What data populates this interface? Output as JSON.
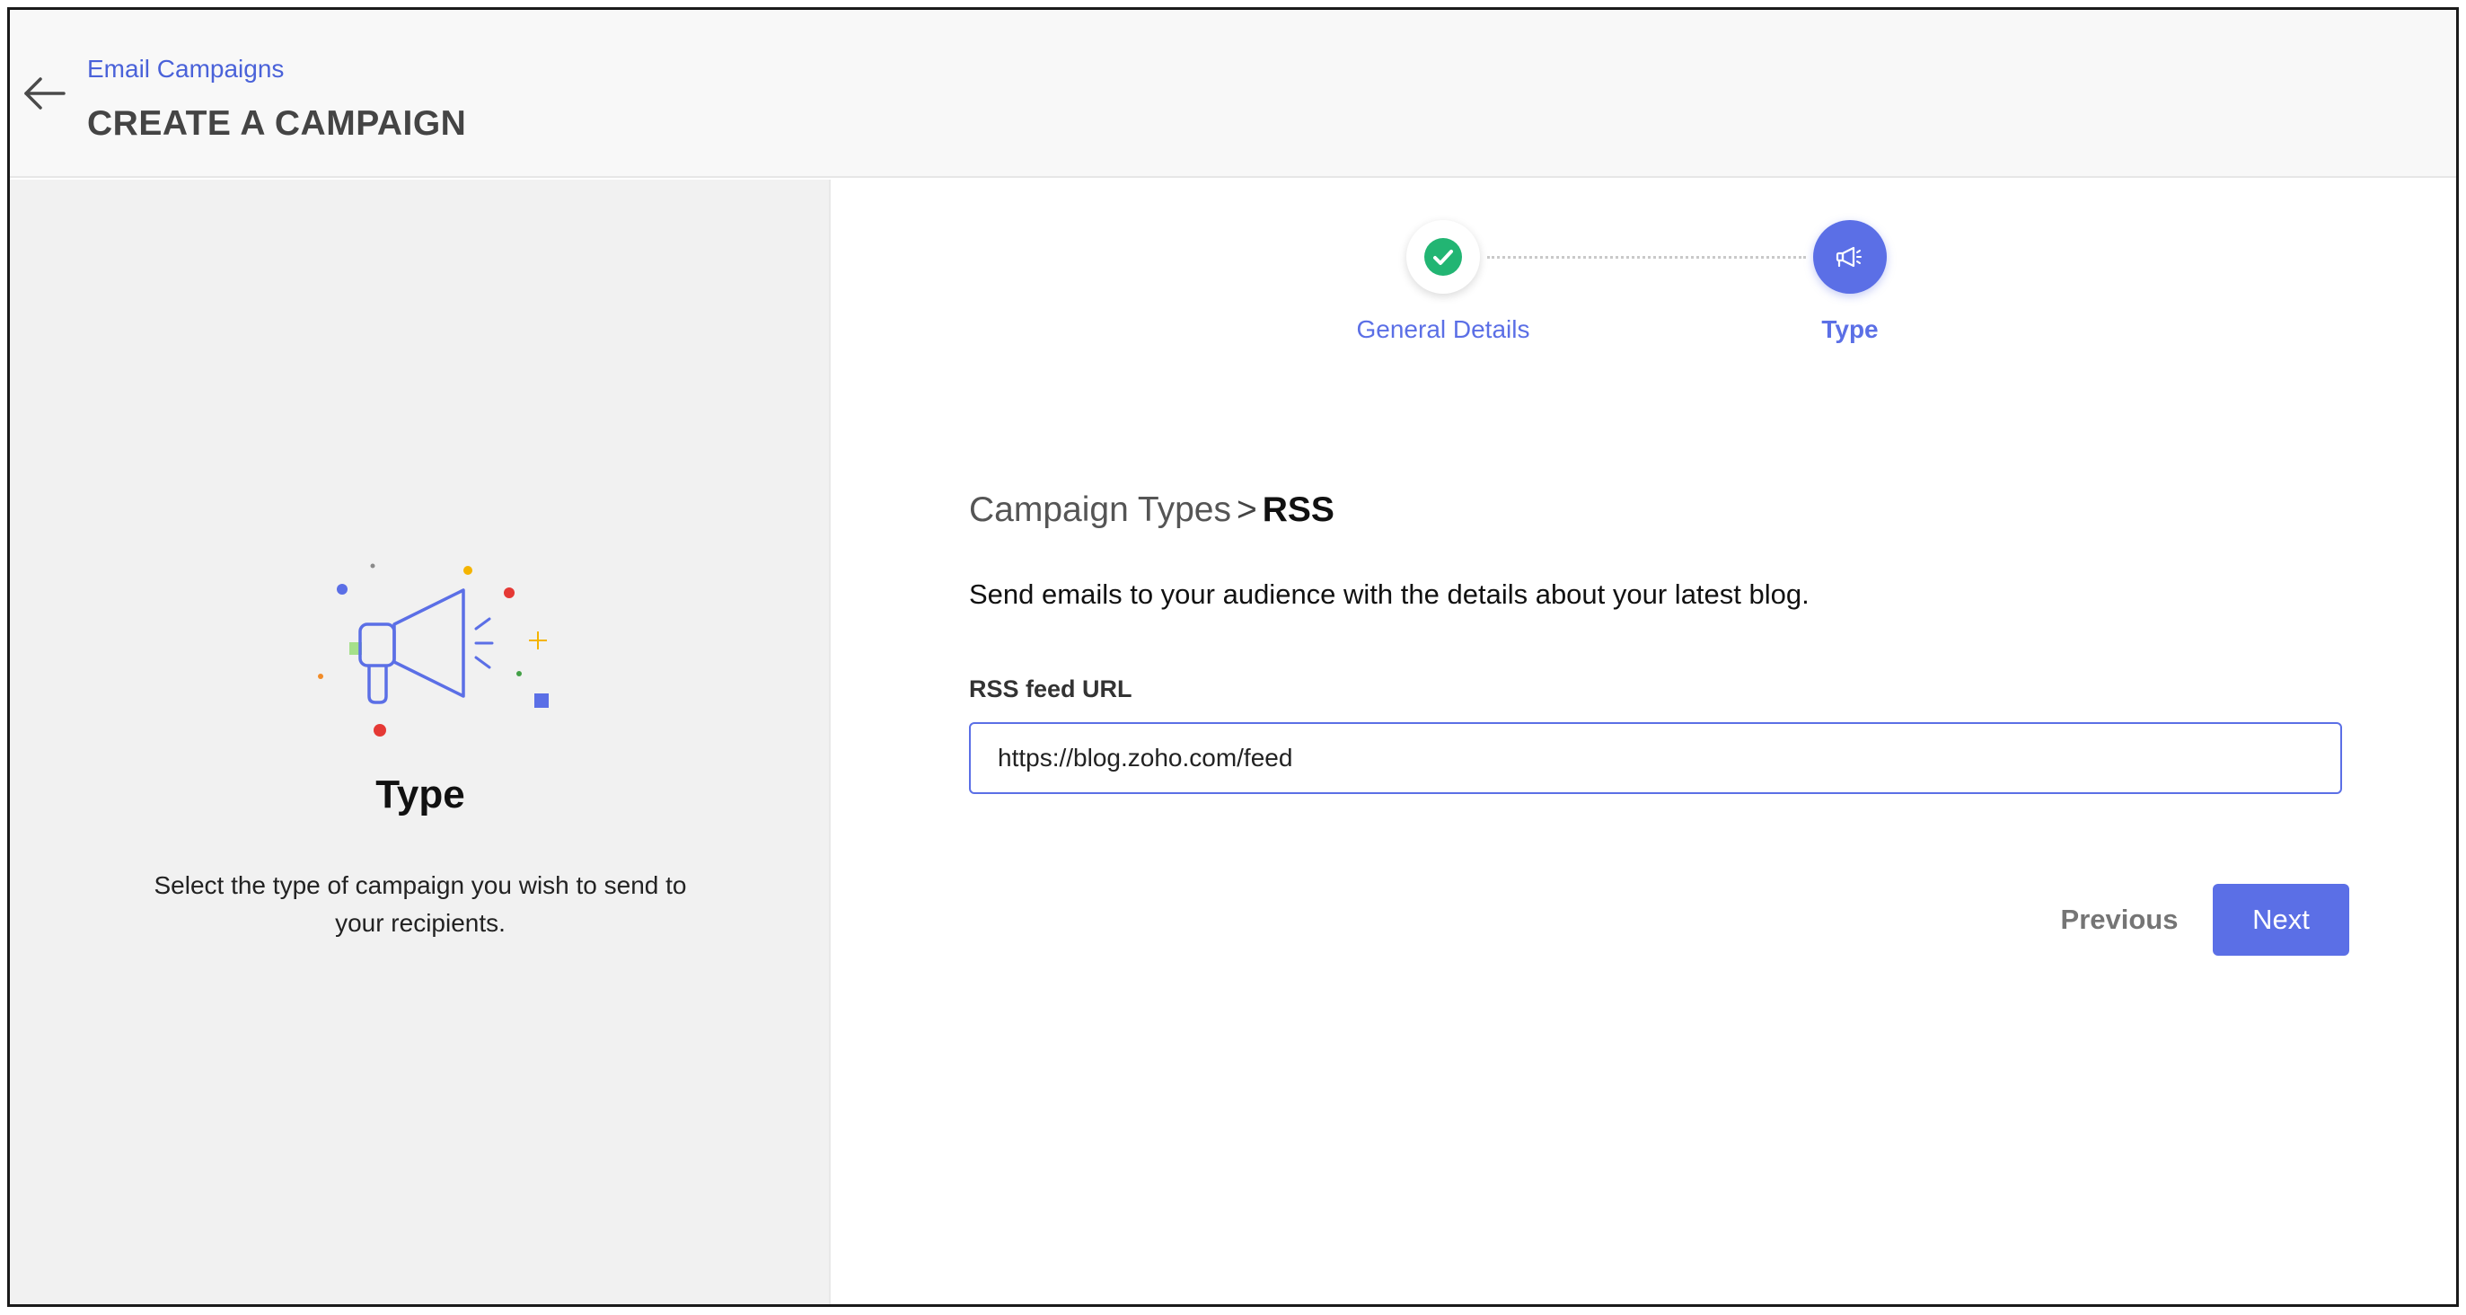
{
  "header": {
    "breadcrumb_link": "Email Campaigns",
    "title": "CREATE A CAMPAIGN",
    "back_icon": "arrow-left-icon"
  },
  "left_panel": {
    "illustration_icon": "megaphone-icon",
    "title": "Type",
    "description": "Select the type of campaign you wish to send to your recipients."
  },
  "stepper": {
    "steps": [
      {
        "label": "General Details",
        "status": "completed",
        "icon": "check-icon"
      },
      {
        "label": "Type",
        "status": "active",
        "icon": "megaphone-icon"
      }
    ]
  },
  "content": {
    "breadcrumb_parent": "Campaign Types",
    "breadcrumb_separator": ">",
    "breadcrumb_current": "RSS",
    "description": "Send emails to your audience with the details about your latest blog.",
    "field_label": "RSS feed URL",
    "field_value": "https://blog.zoho.com/feed"
  },
  "actions": {
    "previous_label": "Previous",
    "next_label": "Next"
  },
  "colors": {
    "accent": "#5b6fe6",
    "link": "#4a62d9",
    "success": "#22b573",
    "left_panel_bg": "#f1f1f1"
  }
}
